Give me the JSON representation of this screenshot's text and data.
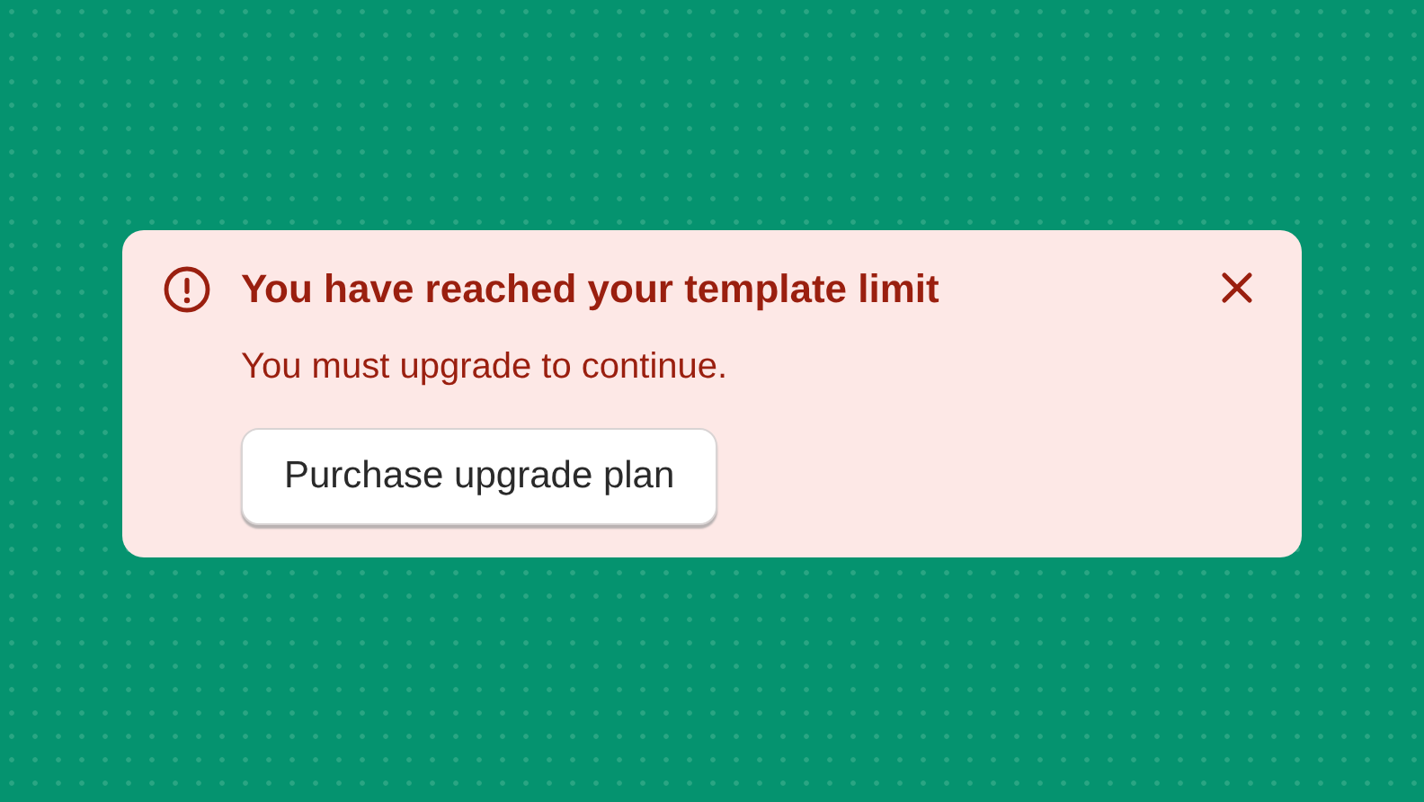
{
  "alert": {
    "title": "You have reached your template limit",
    "message": "You must upgrade to continue.",
    "action": "Purchase upgrade plan",
    "dismissible": true
  }
}
